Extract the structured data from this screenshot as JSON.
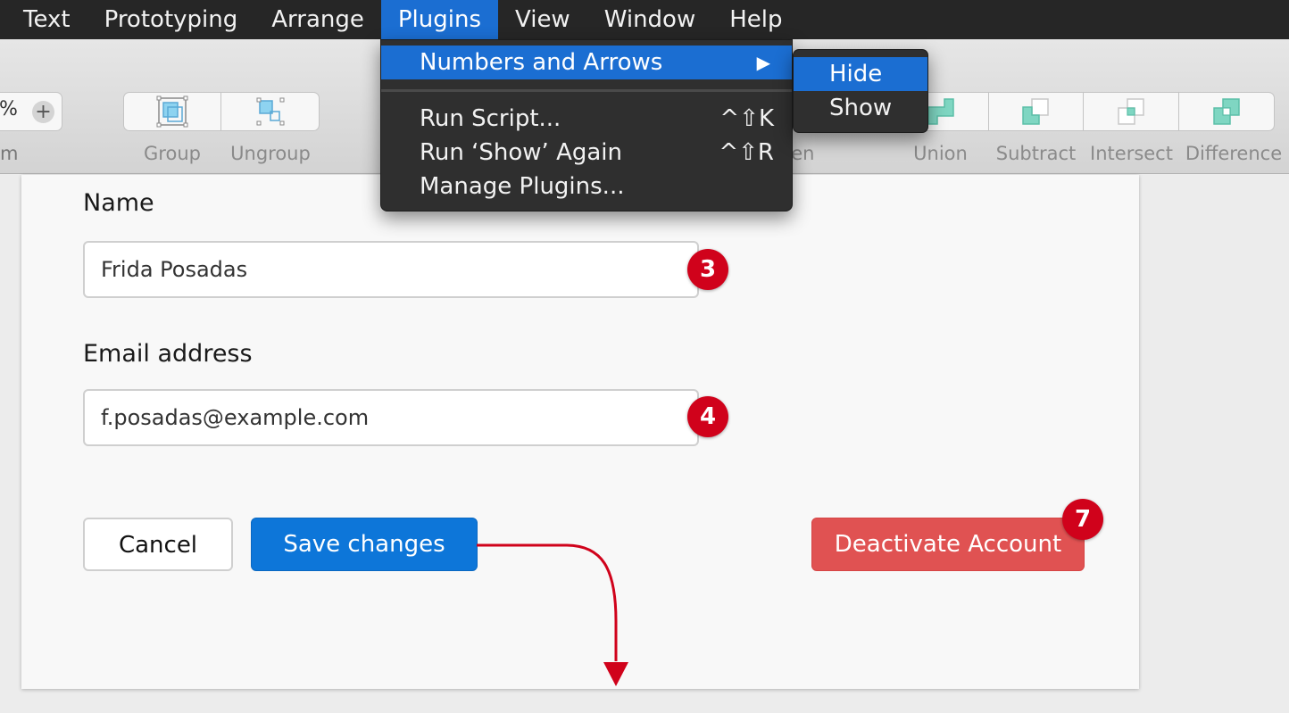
{
  "menubar": {
    "items": [
      {
        "label": "Text"
      },
      {
        "label": "Prototyping"
      },
      {
        "label": "Arrange"
      },
      {
        "label": "Plugins",
        "active": true
      },
      {
        "label": "View"
      },
      {
        "label": "Window"
      },
      {
        "label": "Help"
      }
    ]
  },
  "toolbar": {
    "zoom": {
      "percent_symbol": "%",
      "plus_symbol": "+",
      "label_fragment": "m"
    },
    "group_label": "Group",
    "ungroup_label": "Ungroup",
    "flatten_label_fragment": "ten",
    "union_label": "Union",
    "subtract_label": "Subtract",
    "intersect_label": "Intersect",
    "difference_label": "Difference"
  },
  "plugins_menu": {
    "items": [
      {
        "label": "Numbers and Arrows",
        "submenu_arrow": "▶",
        "highlight": true
      },
      {
        "label": "Run Script...",
        "shortcut": "^⇧K"
      },
      {
        "label": "Run ‘Show’ Again",
        "shortcut": "^⇧R"
      },
      {
        "label": "Manage Plugins..."
      }
    ],
    "submenu": {
      "items": [
        {
          "label": "Hide",
          "highlight": true
        },
        {
          "label": "Show"
        }
      ]
    }
  },
  "form": {
    "name_label": "Name",
    "name_value": "Frida Posadas",
    "email_label": "Email address",
    "email_value": "f.posadas@example.com",
    "cancel_label": "Cancel",
    "save_label": "Save changes",
    "deactivate_label": "Deactivate Account"
  },
  "annotations": {
    "badge_name": "3",
    "badge_email": "4",
    "badge_deactivate": "7"
  },
  "colors": {
    "accent_blue": "#0d76d9",
    "menu_highlight": "#1b6ed2",
    "danger": "#e05252",
    "annotation_red": "#d0021b"
  }
}
